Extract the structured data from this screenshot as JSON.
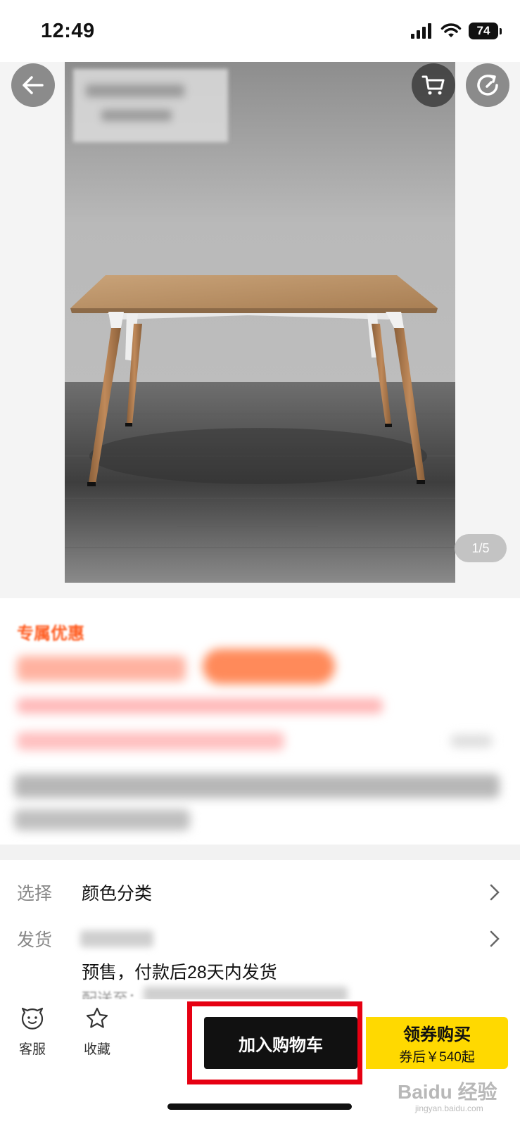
{
  "status_bar": {
    "time": "12:49",
    "battery": "74"
  },
  "gallery": {
    "page_indicator": "1/5"
  },
  "promo": {
    "title": "专属优惠"
  },
  "options": [
    {
      "label": "选择",
      "value": "颜色分类"
    },
    {
      "label": "发货",
      "value": "",
      "detail": "预售，付款后28天内发货",
      "delivery_prefix": "配送至："
    }
  ],
  "bottom_bar": {
    "service_label": "客服",
    "favorite_label": "收藏",
    "add_cart_label": "加入购物车",
    "buy_label": "领券购买",
    "buy_sub": "券后￥540起"
  },
  "watermark": {
    "text": "Baidu 经验",
    "sub": "jingyan.baidu.com"
  },
  "colors": {
    "accent": "#ff5b1f",
    "buy_yellow": "#ffd900",
    "highlight_red": "#e60012"
  },
  "icons": [
    "back-arrow-icon",
    "cart-icon",
    "refresh-icon",
    "chevron-right-icon",
    "service-face-icon",
    "star-icon",
    "signal-icon",
    "wifi-icon"
  ]
}
